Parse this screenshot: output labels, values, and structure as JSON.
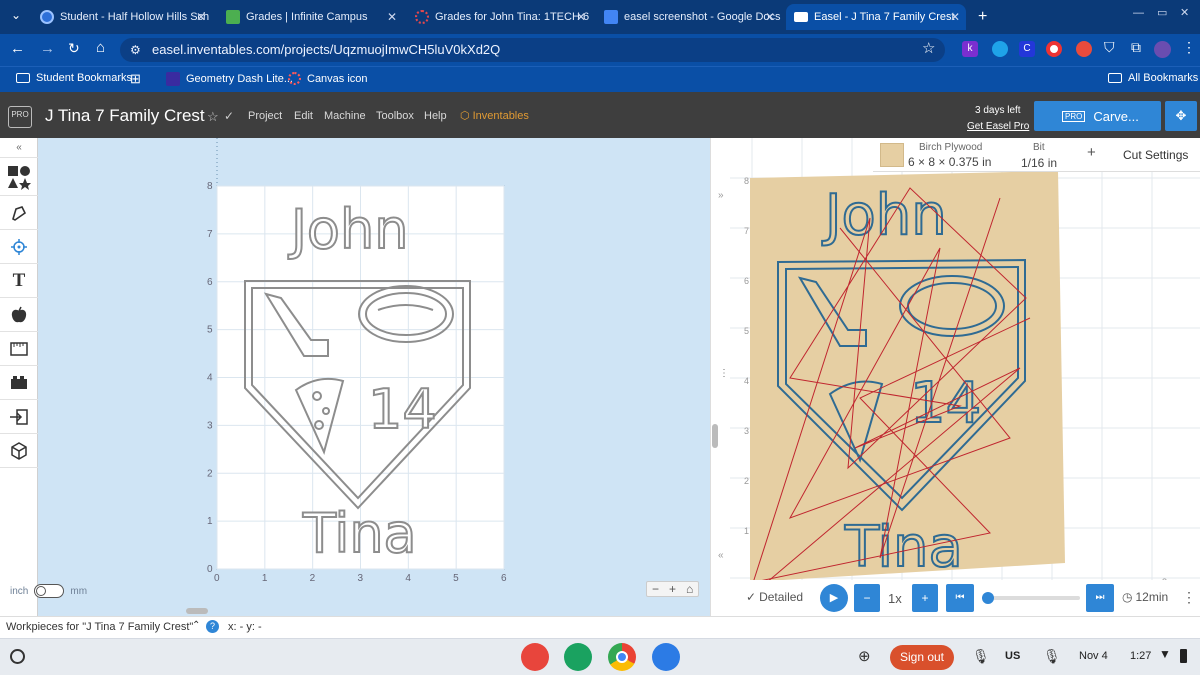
{
  "browser": {
    "tabs": [
      {
        "label": "Student - Half Hollow Hills Sch",
        "active": false
      },
      {
        "label": "Grades | Infinite Campus",
        "active": false
      },
      {
        "label": "Grades for John Tina: 1TECH 6",
        "active": false
      },
      {
        "label": "easel screenshot - Google Docs",
        "active": false
      },
      {
        "label": "Easel - J Tina 7 Family Crest",
        "active": true
      }
    ],
    "url": "easel.inventables.com/projects/UqzmuojImwCH5luV0kXd2Q",
    "bookmarks": [
      "Student Bookmarks",
      "Geometry Dash Lite...",
      "Canvas icon"
    ],
    "all_bookmarks": "All Bookmarks"
  },
  "app": {
    "logo": "PRO",
    "project_title": "J Tina 7 Family Crest",
    "menus": [
      "Project",
      "Edit",
      "Machine",
      "Toolbox",
      "Help"
    ],
    "brand": "Inventables",
    "days_left": "3 days left",
    "get_pro": "Get Easel Pro",
    "carve_badge": "PRO",
    "carve_label": "Carve..."
  },
  "material": {
    "name": "Birch Plywood",
    "dims": "6 × 8 × 0.375 in",
    "bit_label": "Bit",
    "bit_value": "1/16 in",
    "add": "+",
    "cut_settings": "Cut Settings"
  },
  "design": {
    "top_text": "John",
    "number": "14",
    "bottom_text": "Tina",
    "x_ticks": [
      "0",
      "1",
      "2",
      "3",
      "4",
      "5",
      "6"
    ],
    "y_ticks": [
      "8",
      "7",
      "6",
      "5",
      "4",
      "3",
      "2",
      "1",
      "0"
    ]
  },
  "preview": {
    "y_ticks": [
      "8",
      "7",
      "6",
      "5",
      "4",
      "3",
      "2",
      "1"
    ],
    "x_ticks": [
      "1",
      "8"
    ],
    "top_text": "John",
    "number": "14",
    "bottom_text": "Tina",
    "mode": "Detailed",
    "speed": "1x",
    "time": "12min",
    "progress": 0.02
  },
  "units": {
    "left": "inch",
    "right": "mm"
  },
  "zoom": {
    "minus": "−",
    "plus": "+"
  },
  "status": {
    "workpieces": "Workpieces for \"J Tina 7 Family Crest\"",
    "coords": "x: - y: -"
  },
  "taskbar": {
    "sign_out": "Sign out",
    "lang": "US",
    "date": "Nov 4",
    "time": "1:27"
  },
  "colors": {
    "tabbar": "#0b3a78",
    "appbar": "#3e3e3e",
    "carve": "#2f86d6",
    "signout": "#d9502c",
    "wood": "#e6cfa3",
    "carve_line": "#2f6b93",
    "toolpath": "#c0262f"
  }
}
